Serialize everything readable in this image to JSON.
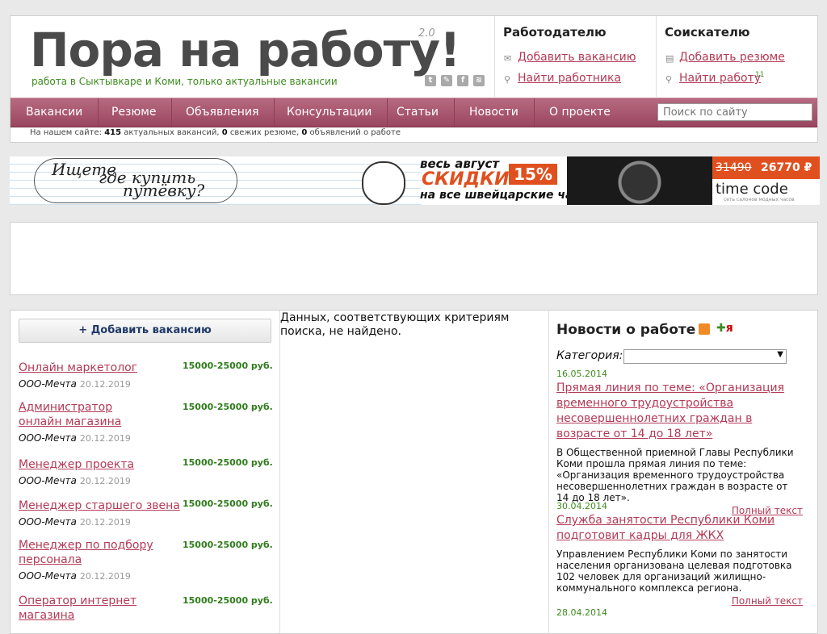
{
  "header": {
    "logo": "Пора на работу!",
    "version": "2.0",
    "tagline": "работа в Сыктывкаре и Коми, только актуальные вакансии",
    "employer": {
      "title": "Работодателю",
      "links": [
        "Добавить вакансию",
        "Найти работника"
      ]
    },
    "seeker": {
      "title": "Соискателю",
      "links": [
        "Добавить резюме",
        "Найти работу"
      ],
      "badge": "11"
    }
  },
  "nav": {
    "items": [
      "Вакансии",
      "Резюме",
      "Объявления",
      "Консультации",
      "Статьи",
      "Новости",
      "О проекте"
    ],
    "search_placeholder": "Поиск по сайту"
  },
  "stats": {
    "prefix": "На нашем сайте:",
    "vacancies": "415",
    "vacancies_label": "актуальных вакансий,",
    "resumes": "0",
    "resumes_label": "свежих резюме,",
    "ads": "0",
    "ads_label": "объявлений о работе"
  },
  "banner": {
    "line1": "Ищете",
    "line2": "где купить",
    "line3": "путёвку?",
    "promo_top": "весь август",
    "promo_main": "СКИДКИ",
    "promo_pct": "15%",
    "promo_bottom": "на все швейцарские часы!",
    "old_price": "31490",
    "new_price": "26770 ₽",
    "brand": "time code",
    "brand_sub": "сеть салонов модных часов"
  },
  "sidebar": {
    "add_button": "+ Добавить вакансию",
    "vacancies": [
      {
        "title": "Онлайн маркетолог",
        "salary": "15000-25000 руб.",
        "company": "ООО-Мечта",
        "date": "20.12.2019"
      },
      {
        "title": "Администратор онлайн магазина",
        "salary": "15000-25000 руб.",
        "company": "ООО-Мечта",
        "date": "20.12.2019"
      },
      {
        "title": "Менеджер проекта",
        "salary": "15000-25000 руб.",
        "company": "ООО-Мечта",
        "date": "20.12.2019"
      },
      {
        "title": "Менеджер старшего звена",
        "salary": "15000-25000 руб.",
        "company": "ООО-Мечта",
        "date": "20.12.2019"
      },
      {
        "title": "Менеджер по подбору персонала",
        "salary": "15000-25000 руб.",
        "company": "ООО-Мечта",
        "date": "20.12.2019"
      },
      {
        "title": "Оператор интернет магазина",
        "salary": "15000-25000 руб.",
        "company": "",
        "date": ""
      }
    ]
  },
  "content": {
    "no_results": "Данных, соответствующих критериям поиска, не найдено."
  },
  "news": {
    "title": "Новости о работе",
    "category_label": "Категория:",
    "category_value": "",
    "more_label": "Полный текст",
    "items": [
      {
        "date": "16.05.2014",
        "headline": "Прямая линия по теме: «Организация временного трудоустройства несовершеннолетних граждан в возрасте от 14 до 18 лет»",
        "text": "В Общественной приемной Главы Республики Коми прошла прямая линия по теме: «Организация временного трудоустройства несовершеннолетних граждан в возрасте от 14 до 18 лет»."
      },
      {
        "date": "30.04.2014",
        "headline": "Служба занятости Республики Коми подготовит кадры для ЖКХ",
        "text": "Управлением Республики Коми по занятости населения организована целевая подготовка 102 человек для организаций жилищно-коммунального комплекса региона."
      },
      {
        "date": "28.04.2014",
        "headline": "",
        "text": ""
      }
    ]
  },
  "colors": {
    "nav": "#a85570",
    "link": "#b33a55",
    "green": "#3d8c1e",
    "promo": "#e0501f"
  }
}
